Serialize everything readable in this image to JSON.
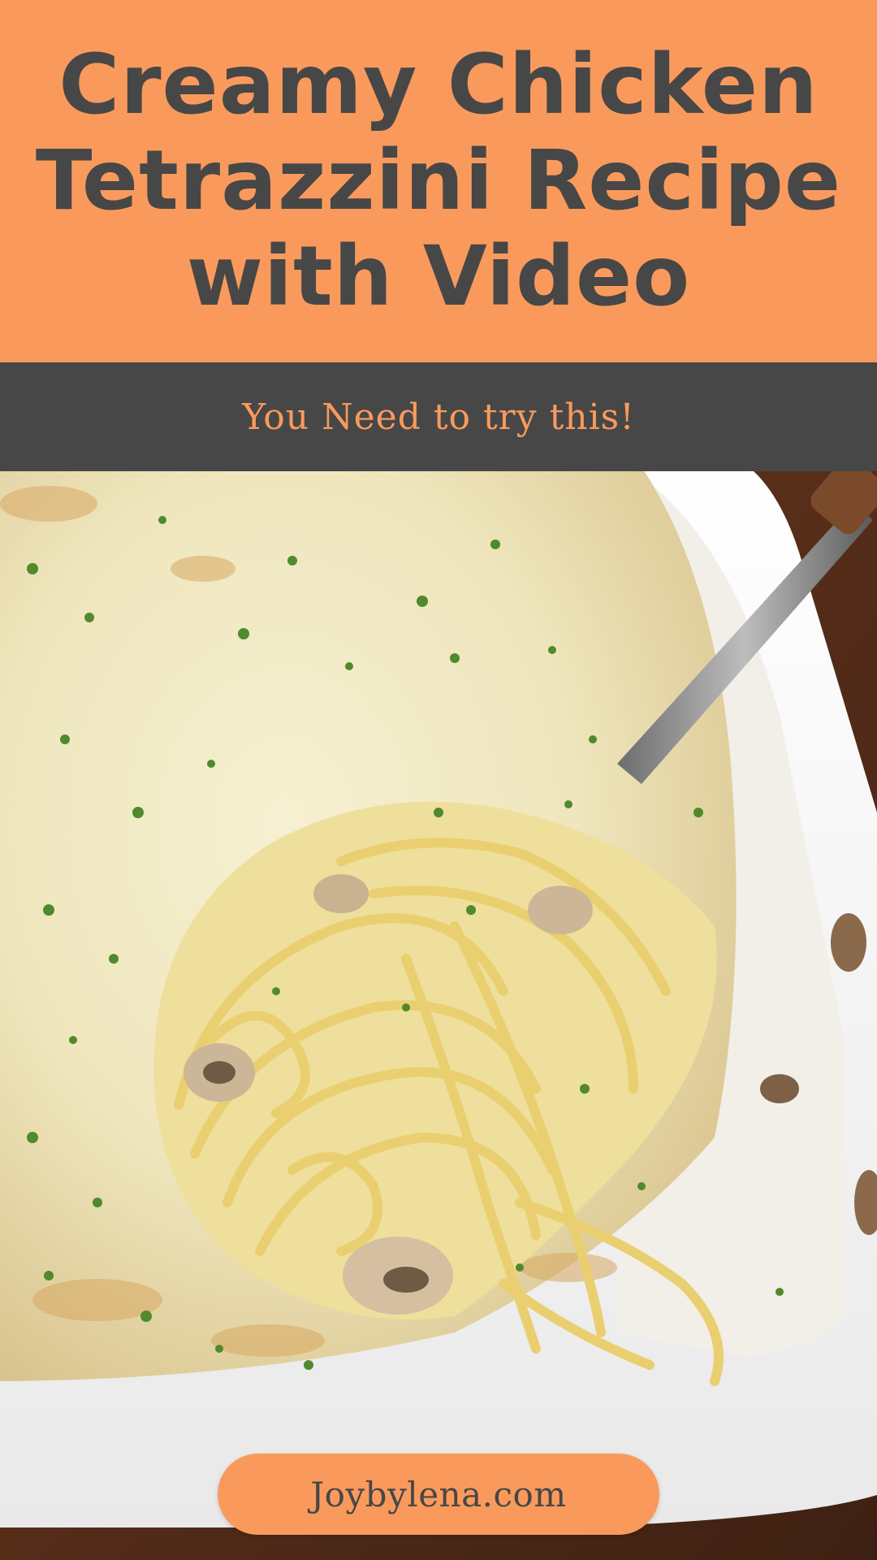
{
  "header": {
    "title": "Creamy Chicken Tetrazzini Recipe with Video"
  },
  "subtitle": {
    "text": "You Need to try this!"
  },
  "photo": {
    "subject": "tetrazzini-dish-photo"
  },
  "footer": {
    "site": "Joybylena.com"
  },
  "colors": {
    "accent": "#f99a5c",
    "dark": "#474747"
  }
}
